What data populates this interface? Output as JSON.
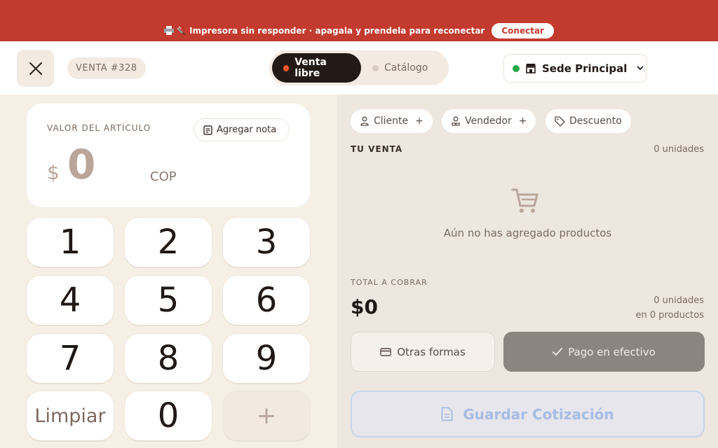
{
  "banner": {
    "icons": [
      "printer-icon",
      "plug-icon"
    ],
    "message": "Impresora sin responder · apagala y prendela para reconectar",
    "connect_label": "Conectar",
    "color": "#c33a2e"
  },
  "header": {
    "sale_number": "VENTA #328",
    "mode_tabs": [
      {
        "label": "Venta libre",
        "active": true,
        "dot_color": "#f0562d"
      },
      {
        "label": "Catálogo",
        "active": false,
        "dot_color": "#d9cbc3"
      }
    ],
    "branch": {
      "label": "Sede Principal",
      "status_color": "#28a745"
    }
  },
  "entry": {
    "label": "VALOR DEL ARTÍCULO",
    "note_button": "Agregar nota",
    "currency_sign": "$",
    "amount": "0",
    "currency": "COP"
  },
  "keypad": {
    "keys": [
      "1",
      "2",
      "3",
      "4",
      "5",
      "6",
      "7",
      "8",
      "9",
      "Limpiar",
      "0",
      "+"
    ]
  },
  "sale": {
    "chips": [
      {
        "label": "Cliente",
        "icon": "person-icon",
        "plus": "+"
      },
      {
        "label": "Vendedor",
        "icon": "seller-icon",
        "plus": "+"
      },
      {
        "label": "Descuento",
        "icon": "tag-icon",
        "plus": ""
      }
    ],
    "title": "TU VENTA",
    "units": "0 unidades",
    "empty_message": "Aún no has agregado productos",
    "total_label": "TOTAL A COBRAR",
    "total_value": "$0",
    "summary_units": "0 unidades",
    "summary_products": "en 0 productos",
    "other_methods_label": "Otras formas",
    "cash_label": "Pago en efectivo",
    "quote_label": "Guardar Cotización"
  }
}
